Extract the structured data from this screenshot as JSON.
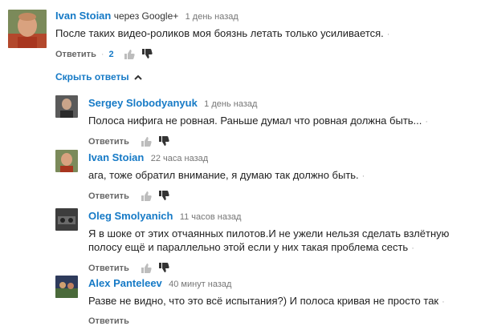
{
  "top_comment": {
    "author": "Ivan Stoian",
    "via": "через Google+",
    "time": "1 день назад",
    "text": "После таких видео-роликов моя боязнь летать только усиливается.",
    "reply_label": "Ответить",
    "likes": "2",
    "avatar_icon": "user-avatar-photo"
  },
  "replies_toggle": {
    "label": "Скрыть ответы",
    "icon": "chevron-up-icon"
  },
  "replies": [
    {
      "author": "Sergey Slobodyanyuk",
      "time": "1 день назад",
      "lines": [
        "Полоса нифига не ровная. Раньше думал что ровная должна быть..."
      ],
      "reply_label": "Ответить"
    },
    {
      "author": "Ivan Stoian",
      "time": "22 часа назад",
      "lines": [
        "ага, тоже обратил внимание, я думаю так должно быть."
      ],
      "reply_label": "Ответить"
    },
    {
      "author": "Oleg Smolyanich",
      "time": "11 часов назад",
      "lines": [
        "Я в шоке от этих отчаянных пилотов.И не ужели нельзя сделать взлётную",
        "полосу ещё и параллельно этой  если у них такая проблема сесть"
      ],
      "reply_label": "Ответить"
    },
    {
      "author": "Alex Panteleev",
      "time": "40 минут назад",
      "lines": [
        "Разве не видно, что это всё испытания?) И полоса кривая не просто так"
      ],
      "reply_label": "Ответить"
    }
  ],
  "colors": {
    "link": "#167ac6",
    "text": "#222222",
    "muted": "#767676"
  }
}
